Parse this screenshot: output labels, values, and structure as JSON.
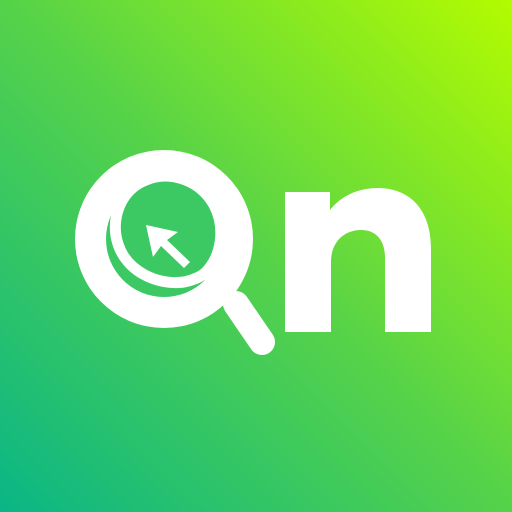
{
  "icon": {
    "logo_name": "On",
    "colors": {
      "gradient_start": "#0AB686",
      "gradient_mid": "#55D24A",
      "gradient_end": "#B2FC00",
      "foreground": "#FFFFFF",
      "accent": "#3CC964"
    }
  }
}
